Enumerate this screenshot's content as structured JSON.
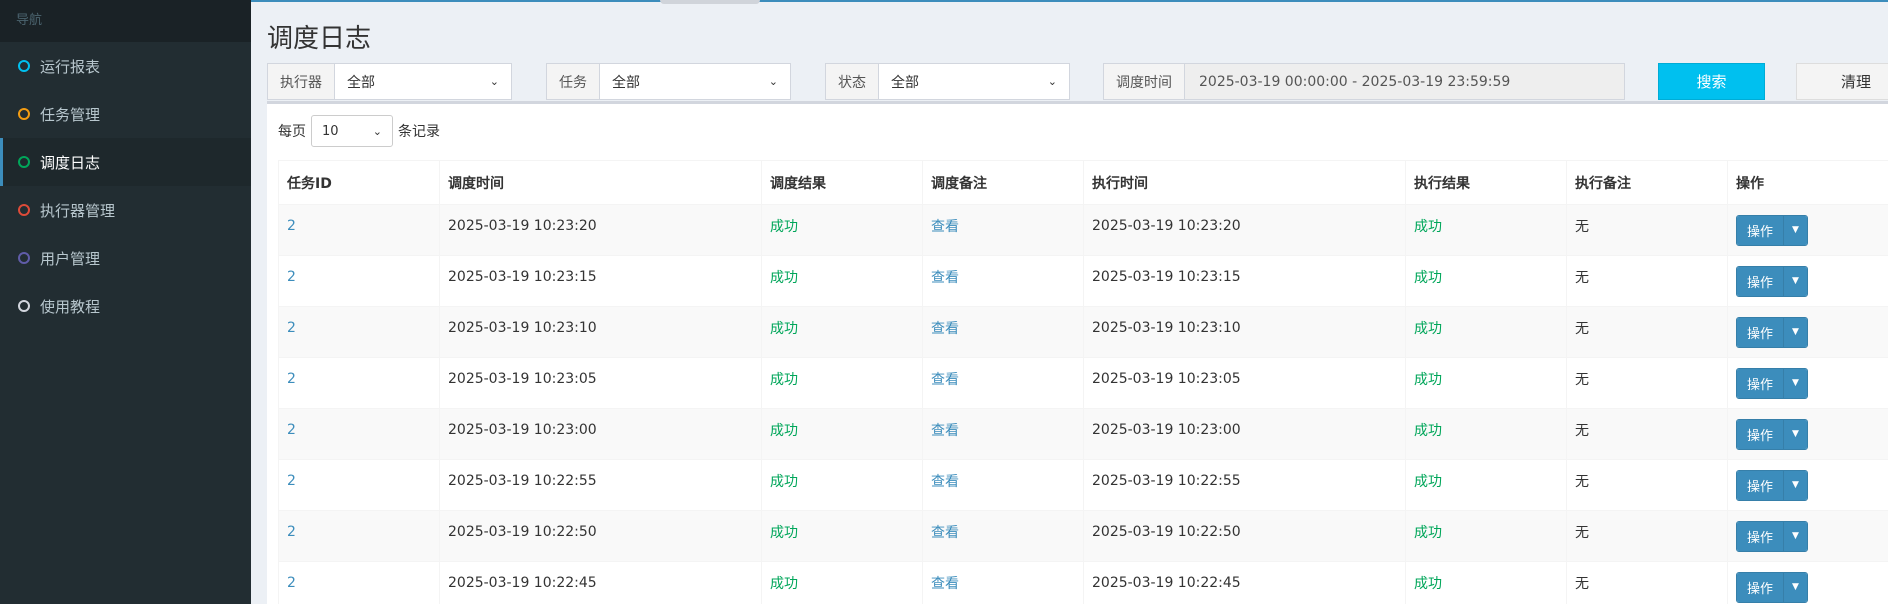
{
  "sidebar": {
    "header": "导航",
    "items": [
      {
        "label": "运行报表",
        "dot_color": "#00c0ef",
        "active": false
      },
      {
        "label": "任务管理",
        "dot_color": "#f39c12",
        "active": false
      },
      {
        "label": "调度日志",
        "dot_color": "#00a65a",
        "active": true
      },
      {
        "label": "执行器管理",
        "dot_color": "#dd4b39",
        "active": false
      },
      {
        "label": "用户管理",
        "dot_color": "#605ca8",
        "active": false
      },
      {
        "label": "使用教程",
        "dot_color": "#d2d6de",
        "active": false
      }
    ]
  },
  "page_title": "调度日志",
  "filters": {
    "executor": {
      "label": "执行器",
      "value": "全部"
    },
    "task": {
      "label": "任务",
      "value": "全部"
    },
    "status": {
      "label": "状态",
      "value": "全部"
    },
    "time": {
      "label": "调度时间",
      "value": "2025-03-19 00:00:00 - 2025-03-19 23:59:59"
    },
    "search_label": "搜索",
    "clear_label": "清理"
  },
  "page_size": {
    "prefix": "每页",
    "value": "10",
    "suffix": "条记录"
  },
  "table": {
    "columns": [
      "任务ID",
      "调度时间",
      "调度结果",
      "调度备注",
      "执行时间",
      "执行结果",
      "执行备注",
      "操作"
    ],
    "op_label": "操作",
    "rows": [
      {
        "task_id": "2",
        "trigger_time": "2025-03-19 10:23:20",
        "trigger_result": "成功",
        "trigger_msg": "查看",
        "handle_time": "2025-03-19 10:23:20",
        "handle_result": "成功",
        "handle_msg": "无"
      },
      {
        "task_id": "2",
        "trigger_time": "2025-03-19 10:23:15",
        "trigger_result": "成功",
        "trigger_msg": "查看",
        "handle_time": "2025-03-19 10:23:15",
        "handle_result": "成功",
        "handle_msg": "无"
      },
      {
        "task_id": "2",
        "trigger_time": "2025-03-19 10:23:10",
        "trigger_result": "成功",
        "trigger_msg": "查看",
        "handle_time": "2025-03-19 10:23:10",
        "handle_result": "成功",
        "handle_msg": "无"
      },
      {
        "task_id": "2",
        "trigger_time": "2025-03-19 10:23:05",
        "trigger_result": "成功",
        "trigger_msg": "查看",
        "handle_time": "2025-03-19 10:23:05",
        "handle_result": "成功",
        "handle_msg": "无"
      },
      {
        "task_id": "2",
        "trigger_time": "2025-03-19 10:23:00",
        "trigger_result": "成功",
        "trigger_msg": "查看",
        "handle_time": "2025-03-19 10:23:00",
        "handle_result": "成功",
        "handle_msg": "无"
      },
      {
        "task_id": "2",
        "trigger_time": "2025-03-19 10:22:55",
        "trigger_result": "成功",
        "trigger_msg": "查看",
        "handle_time": "2025-03-19 10:22:55",
        "handle_result": "成功",
        "handle_msg": "无"
      },
      {
        "task_id": "2",
        "trigger_time": "2025-03-19 10:22:50",
        "trigger_result": "成功",
        "trigger_msg": "查看",
        "handle_time": "2025-03-19 10:22:50",
        "handle_result": "成功",
        "handle_msg": "无"
      },
      {
        "task_id": "2",
        "trigger_time": "2025-03-19 10:22:45",
        "trigger_result": "成功",
        "trigger_msg": "查看",
        "handle_time": "2025-03-19 10:22:45",
        "handle_result": "成功",
        "handle_msg": "无"
      }
    ]
  },
  "colors": {
    "sidebar_bg": "#222d32",
    "accent": "#3c8dbc",
    "search_button": "#00c0ef",
    "success_text": "#00a65a"
  }
}
